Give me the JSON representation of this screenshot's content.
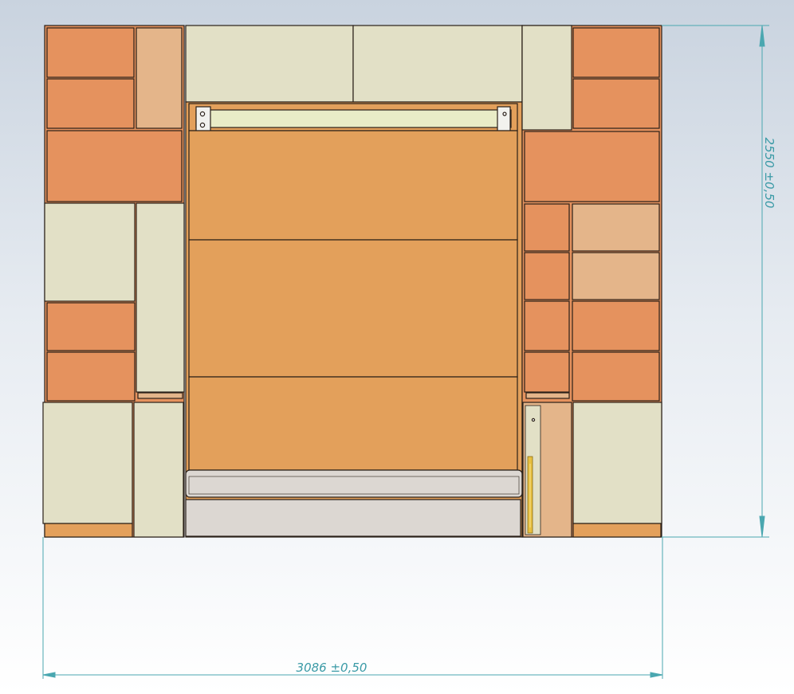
{
  "drawing": {
    "width_dimension": "3086 ±0,50",
    "height_dimension": "2550 ±0,50"
  },
  "colors": {
    "drawer_front": "#e5925e",
    "light_wood": "#e4b58a",
    "cream_panel": "#e2e0c6",
    "bed_panel": "#e3a05b",
    "grey_base": "#dcd7d2",
    "dimension_line": "#4aa7b0",
    "outline": "#2a2018"
  }
}
